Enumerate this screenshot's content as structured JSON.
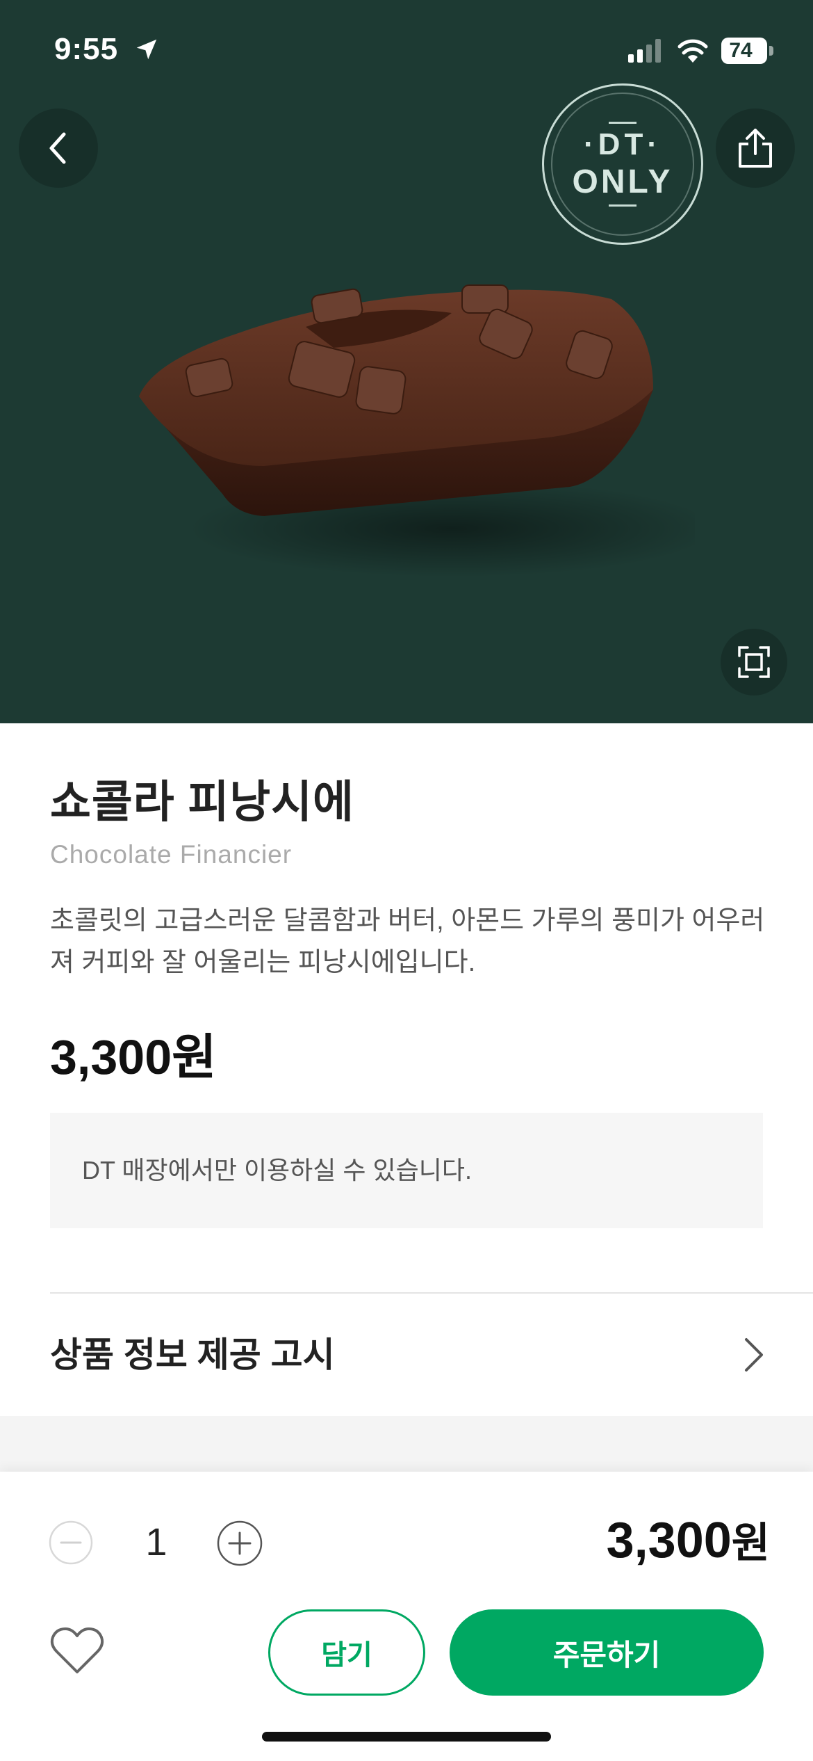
{
  "status_bar": {
    "time": "9:55",
    "battery": "74"
  },
  "hero": {
    "background_color": "#1d3a33",
    "badge": {
      "line1": "·DT·",
      "line2": "ONLY"
    },
    "icons": {
      "back": "chevron-left-icon",
      "share": "share-icon",
      "expand": "expand-icon"
    }
  },
  "product": {
    "name": "쇼콜라 피낭시에",
    "name_en": "Chocolate Financier",
    "description": "초콜릿의 고급스러운 달콤함과 버터, 아몬드 가루의 풍미가 어우러져 커피와 잘 어울리는 피낭시에입니다.",
    "price": "3,300원"
  },
  "notice": "DT 매장에서만 이용하실 수 있습니다.",
  "info_row": {
    "label": "상품 정보 제공 고시"
  },
  "order_bar": {
    "quantity": "1",
    "total_number": "3,300",
    "total_unit": "원",
    "cart_label": "담기",
    "order_label": "주문하기",
    "accent_color": "#00a862"
  }
}
